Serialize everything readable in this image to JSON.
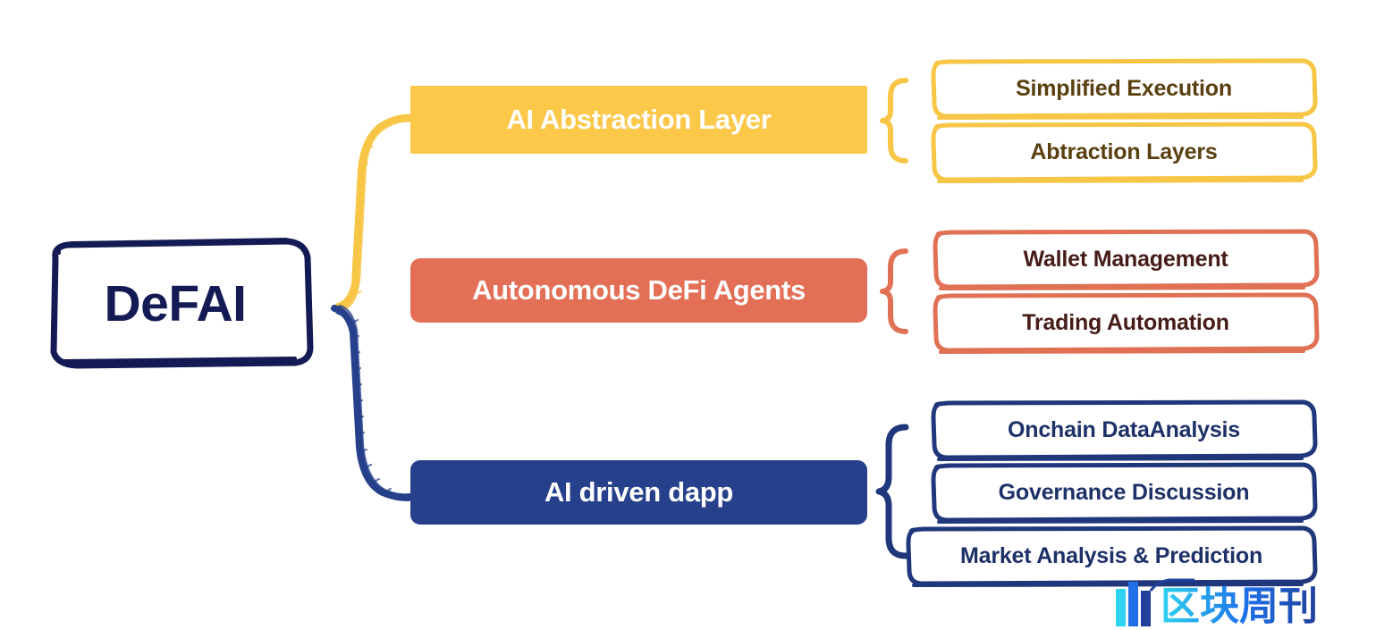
{
  "diagram": {
    "type": "hierarchy-mindmap",
    "background_color": "#FFFFFF",
    "root": {
      "label": "DeFAI",
      "text_color": "#141B54",
      "border_color": "#141B54",
      "style": "hand-drawn-rounded-rect"
    },
    "branches": [
      {
        "id": "ai-abstraction-layer",
        "label": "AI Abstraction Layer",
        "color": "#FCC84A",
        "text_color": "#FFFFFF",
        "brace": "{",
        "items": [
          {
            "label": "Simplified Execution",
            "text_color": "#5A4010",
            "border_color": "#F8C646"
          },
          {
            "label": "Abtraction Layers",
            "text_color": "#5A4010",
            "border_color": "#F8C646"
          }
        ]
      },
      {
        "id": "autonomous-defi-agents",
        "label": "Autonomous DeFi Agents",
        "color": "#E36F56",
        "text_color": "#FFFFFF",
        "brace": "{",
        "items": [
          {
            "label": "Wallet Management",
            "text_color": "#451C18",
            "border_color": "#E07155"
          },
          {
            "label": "Trading Automation",
            "text_color": "#451C18",
            "border_color": "#E07155"
          }
        ]
      },
      {
        "id": "ai-driven-dapp",
        "label": "AI driven dapp",
        "color": "#26408B",
        "text_color": "#FFFFFF",
        "brace": "{",
        "items": [
          {
            "label": "Onchain DataAnalysis",
            "text_color": "#1D3168",
            "border_color": "#21377C"
          },
          {
            "label": "Governance Discussion",
            "text_color": "#1D3168",
            "border_color": "#21377C"
          },
          {
            "label": "Market Analysis & Prediction",
            "text_color": "#1D3168",
            "border_color": "#21377C"
          }
        ]
      }
    ],
    "connectors": [
      {
        "from": "DeFAI",
        "to": "AI Abstraction Layer",
        "color": "#F8C646",
        "style": "sketchy-curve"
      },
      {
        "from": "DeFAI",
        "to": "AI driven dapp",
        "color": "#26408B",
        "style": "sketchy-curve"
      }
    ],
    "watermark": {
      "name": "区块周刊",
      "mark_colors": [
        "#2ED3F0",
        "#1E6FE8",
        "#20409B"
      ]
    }
  }
}
